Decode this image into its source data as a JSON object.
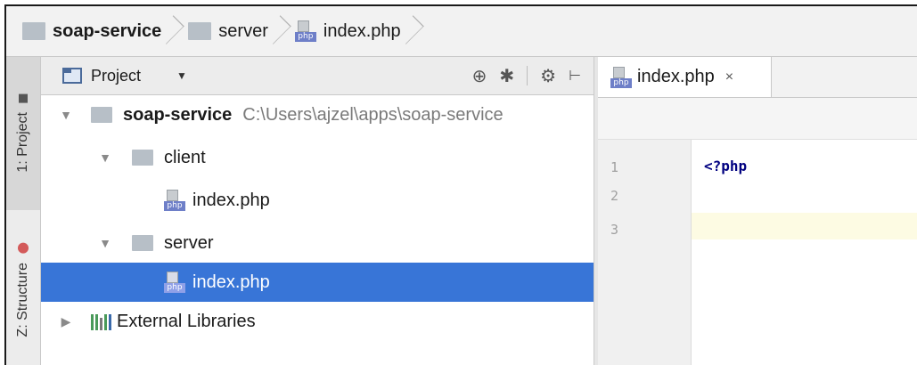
{
  "breadcrumb": {
    "items": [
      {
        "label": "soap-service",
        "icon": "folder-icon",
        "bold": true
      },
      {
        "label": "server",
        "icon": "folder-icon",
        "bold": false
      },
      {
        "label": "index.php",
        "icon": "php-file-icon",
        "bold": false
      }
    ]
  },
  "tool_strip": {
    "project_label": "1: Project",
    "structure_label": "Z: Structure"
  },
  "project_panel": {
    "title": "Project",
    "tools": [
      "target-icon",
      "collapse-icon",
      "gear-icon",
      "hide-icon"
    ],
    "tree": [
      {
        "label": "soap-service",
        "path": "C:\\Users\\ajzel\\apps\\soap-service",
        "type": "folder",
        "expanded": true
      },
      {
        "label": "client",
        "type": "folder",
        "expanded": true
      },
      {
        "label": "index.php",
        "type": "php"
      },
      {
        "label": "server",
        "type": "folder",
        "expanded": true
      },
      {
        "label": "index.php",
        "type": "php",
        "selected": true
      },
      {
        "label": "External Libraries",
        "type": "libraries",
        "expanded": false
      }
    ]
  },
  "editor": {
    "tab_label": "index.php",
    "tab_close": "×",
    "line_numbers": [
      "1",
      "2",
      "3"
    ],
    "code": [
      "<?php",
      "",
      ""
    ]
  },
  "icons": {
    "php_label": "php"
  },
  "colors": {
    "selection": "#3875d7",
    "caret_line": "#fdfbe3",
    "php_tag": "#000080",
    "folder": "#b7bfc7"
  }
}
